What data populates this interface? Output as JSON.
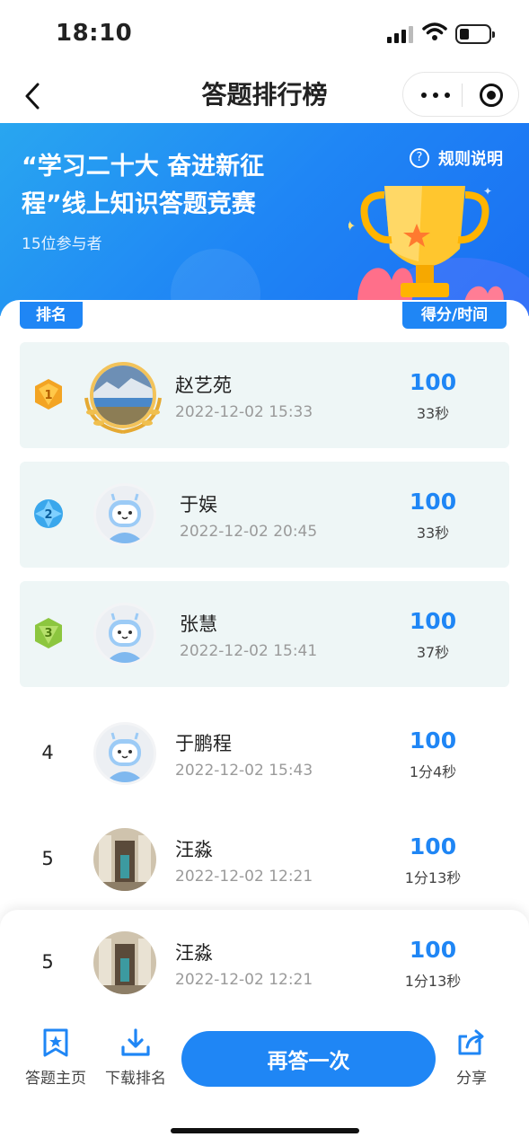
{
  "status_bar": {
    "time": "18:10"
  },
  "nav": {
    "title": "答题排行榜"
  },
  "banner": {
    "title_line1": "“学习二十大 奋进新征",
    "title_line2": "程”线上知识答题竞赛",
    "participants": "15位参与者",
    "rules_icon": "?",
    "rules_label": "规则说明"
  },
  "columns": {
    "rank": "排名",
    "score": "得分/时间"
  },
  "rows": [
    {
      "rank": "1",
      "name": "赵艺苑",
      "date": "2022-12-02 15:33",
      "score": "100",
      "time": "33秒"
    },
    {
      "rank": "2",
      "name": "于娱",
      "date": "2022-12-02 20:45",
      "score": "100",
      "time": "33秒"
    },
    {
      "rank": "3",
      "name": "张慧",
      "date": "2022-12-02 15:41",
      "score": "100",
      "time": "37秒"
    },
    {
      "rank": "4",
      "name": "于鹏程",
      "date": "2022-12-02 15:43",
      "score": "100",
      "time": "1分4秒"
    },
    {
      "rank": "5",
      "name": "汪淼",
      "date": "2022-12-02 12:21",
      "score": "100",
      "time": "1分13秒"
    }
  ],
  "my_rank": {
    "rank": "5",
    "name": "汪淼",
    "date": "2022-12-02 12:21",
    "score": "100",
    "time": "1分13秒"
  },
  "tabbar": {
    "home_label": "答题主页",
    "download_label": "下载排名",
    "retry_label": "再答一次",
    "share_label": "分享"
  },
  "colors": {
    "accent": "#1f86f5",
    "gold": "#f3a423",
    "blue_medal": "#3aa7ec",
    "green_medal": "#8cc63f"
  }
}
